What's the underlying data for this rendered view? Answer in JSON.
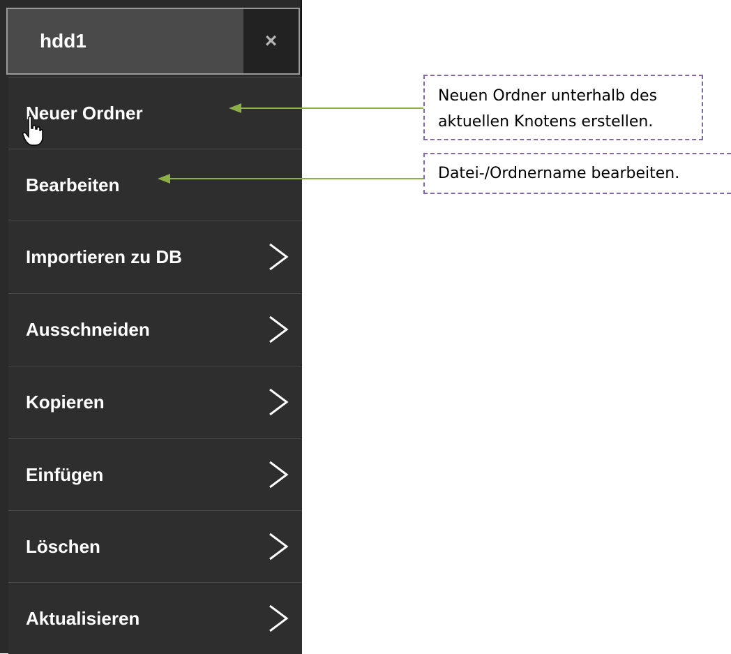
{
  "menu": {
    "title": "hdd1",
    "close_label": "×",
    "items": [
      {
        "label": "Neuer Ordner",
        "has_submenu": false
      },
      {
        "label": "Bearbeiten",
        "has_submenu": false
      },
      {
        "label": "Importieren zu DB",
        "has_submenu": true
      },
      {
        "label": "Ausschneiden",
        "has_submenu": true
      },
      {
        "label": "Kopieren",
        "has_submenu": true
      },
      {
        "label": "Einfügen",
        "has_submenu": true
      },
      {
        "label": "Löschen",
        "has_submenu": true
      },
      {
        "label": "Aktualisieren",
        "has_submenu": true
      }
    ]
  },
  "annotations": {
    "new_folder_line1": "Neuen Ordner unterhalb des",
    "new_folder_line2": "aktuellen Knotens erstellen.",
    "edit": "Datei-/Ordnername bearbeiten."
  },
  "colors": {
    "menu_bg": "#2e2e2e",
    "header_bg": "#4a4a4a",
    "arrow": "#8db046",
    "callout_border": "#8068a8"
  },
  "icons": {
    "close": "close-icon",
    "submenu": "chevron-right-icon",
    "cursor": "hand-pointer-icon"
  }
}
